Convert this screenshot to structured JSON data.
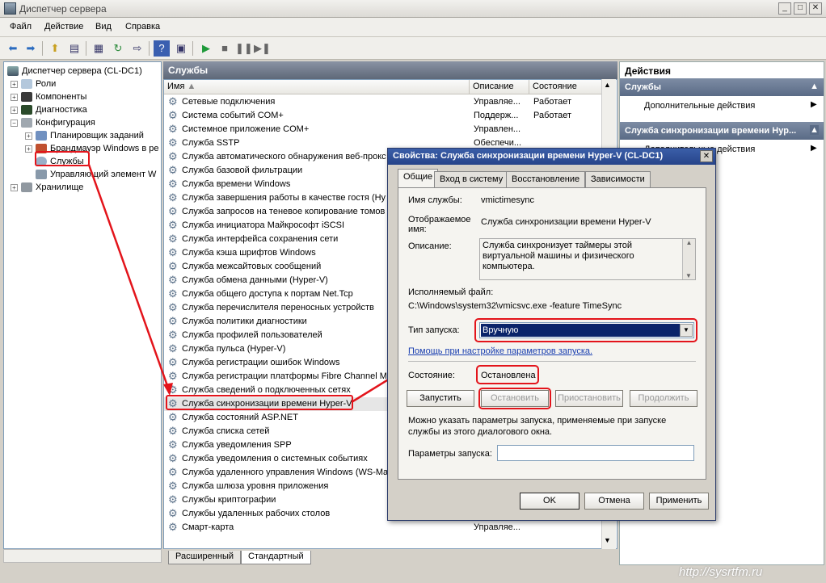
{
  "window": {
    "title": "Диспетчер сервера"
  },
  "menu": [
    "Файл",
    "Действие",
    "Вид",
    "Справка"
  ],
  "tree": [
    {
      "label": "Диспетчер сервера (CL-DC1)",
      "depth": 0,
      "expander": ""
    },
    {
      "label": "Роли",
      "depth": 1,
      "expander": "+"
    },
    {
      "label": "Компоненты",
      "depth": 1,
      "expander": "+"
    },
    {
      "label": "Диагностика",
      "depth": 1,
      "expander": "+"
    },
    {
      "label": "Конфигурация",
      "depth": 1,
      "expander": "−"
    },
    {
      "label": "Планировщик заданий",
      "depth": 2,
      "expander": "+"
    },
    {
      "label": "Брандмауэр Windows в ре",
      "depth": 2,
      "expander": "+"
    },
    {
      "label": "Службы",
      "depth": 2,
      "expander": ""
    },
    {
      "label": "Управляющий элемент W",
      "depth": 2,
      "expander": ""
    },
    {
      "label": "Хранилище",
      "depth": 1,
      "expander": "+"
    }
  ],
  "services_panel": {
    "title": "Службы",
    "columns": {
      "name": "Имя",
      "desc": "Описание",
      "state": "Состояние"
    },
    "rows": [
      {
        "name": "Сетевые подключения",
        "desc": "Управляе...",
        "state": "Работает"
      },
      {
        "name": "Система событий COM+",
        "desc": "Поддерж...",
        "state": "Работает"
      },
      {
        "name": "Системное приложение COM+",
        "desc": "Управлен...",
        "state": ""
      },
      {
        "name": "Служба SSTP",
        "desc": "Обеспечи...",
        "state": ""
      },
      {
        "name": "Служба автоматического обнаружения веб-прокс",
        "desc": "",
        "state": ""
      },
      {
        "name": "Служба базовой фильтрации",
        "desc": "",
        "state": ""
      },
      {
        "name": "Служба времени Windows",
        "desc": "",
        "state": ""
      },
      {
        "name": "Служба завершения работы в качестве гостя (Hy",
        "desc": "",
        "state": ""
      },
      {
        "name": "Служба запросов на теневое копирование томов",
        "desc": "",
        "state": ""
      },
      {
        "name": "Служба инициатора Майкрософт iSCSI",
        "desc": "",
        "state": ""
      },
      {
        "name": "Служба интерфейса сохранения сети",
        "desc": "",
        "state": ""
      },
      {
        "name": "Служба кэша шрифтов Windows",
        "desc": "",
        "state": ""
      },
      {
        "name": "Служба межсайтовых сообщений",
        "desc": "",
        "state": ""
      },
      {
        "name": "Служба обмена данными (Hyper-V)",
        "desc": "",
        "state": ""
      },
      {
        "name": "Служба общего доступа к портам Net.Tcp",
        "desc": "",
        "state": ""
      },
      {
        "name": "Служба перечислителя переносных устройств",
        "desc": "",
        "state": ""
      },
      {
        "name": "Служба политики диагностики",
        "desc": "",
        "state": ""
      },
      {
        "name": "Служба профилей пользователей",
        "desc": "",
        "state": ""
      },
      {
        "name": "Служба пульса (Hyper-V)",
        "desc": "",
        "state": ""
      },
      {
        "name": "Служба регистрации ошибок Windows",
        "desc": "",
        "state": ""
      },
      {
        "name": "Служба регистрации платформы Fibre Channel Mic",
        "desc": "",
        "state": ""
      },
      {
        "name": "Служба сведений о подключенных сетях",
        "desc": "",
        "state": ""
      },
      {
        "name": "Служба синхронизации времени Hyper-V",
        "desc": "",
        "state": ""
      },
      {
        "name": "Служба состояний ASP.NET",
        "desc": "",
        "state": ""
      },
      {
        "name": "Служба списка сетей",
        "desc": "",
        "state": ""
      },
      {
        "name": "Служба уведомления SPP",
        "desc": "",
        "state": ""
      },
      {
        "name": "Служба уведомления о системных событиях",
        "desc": "",
        "state": ""
      },
      {
        "name": "Служба удаленного управления Windows (WS-Ma",
        "desc": "",
        "state": ""
      },
      {
        "name": "Служба шлюза уровня приложения",
        "desc": "",
        "state": ""
      },
      {
        "name": "Службы криптографии",
        "desc": "",
        "state": ""
      },
      {
        "name": "Службы удаленных рабочих столов",
        "desc": "",
        "state": ""
      },
      {
        "name": "Смарт-карта",
        "desc": "Управляе...",
        "state": ""
      }
    ],
    "tabs": [
      "Расширенный",
      "Стандартный"
    ]
  },
  "actions": {
    "header": "Действия",
    "sec1": "Службы",
    "sec1_item": "Дополнительные действия",
    "sec2": "Служба синхронизации времени Hyp...",
    "sec2_item": "Дополнительные действия"
  },
  "dialog": {
    "title": "Свойства: Служба синхронизации времени Hyper-V (CL-DC1)",
    "tabs": [
      "Общие",
      "Вход в систему",
      "Восстановление",
      "Зависимости"
    ],
    "service_name_label": "Имя службы:",
    "service_name": "vmictimesync",
    "display_name_label_1": "Отображаемое",
    "display_name_label_2": "имя:",
    "display_name": "Служба синхронизации времени Hyper-V",
    "description_label": "Описание:",
    "description": "Служба синхронизует таймеры этой виртуальной машины и физического компьютера.",
    "exe_label": "Исполняемый файл:",
    "exe_path": "C:\\Windows\\system32\\vmicsvc.exe -feature TimeSync",
    "startup_label": "Тип запуска:",
    "startup_value": "Вручную",
    "help_link": "Помощь при настройке параметров запуска.",
    "state_label": "Состояние:",
    "state_value": "Остановлена",
    "btn_start": "Запустить",
    "btn_stop": "Остановить",
    "btn_pause": "Приостановить",
    "btn_resume": "Продолжить",
    "hint": "Можно указать параметры запуска, применяемые при запуске службы из этого диалогового окна.",
    "params_label": "Параметры запуска:",
    "params_value": "",
    "ok": "OK",
    "cancel": "Отмена",
    "apply": "Применить"
  },
  "watermark": "http://sysrtfm.ru",
  "colors": {
    "highlight": "#e3141b",
    "title_blue": "#27448a"
  }
}
